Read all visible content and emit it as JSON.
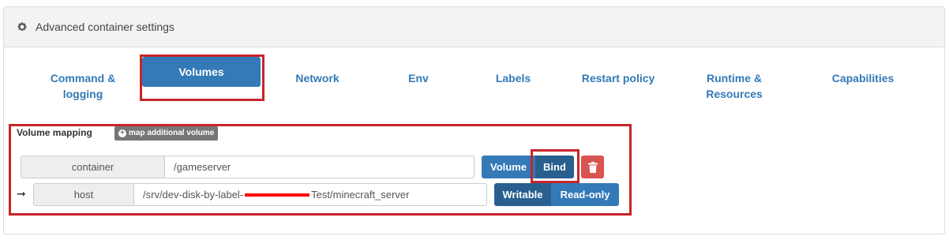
{
  "panel": {
    "title": "Advanced container settings",
    "header_icon": "gear-icon"
  },
  "tabs": [
    {
      "label_lines": [
        "Command &",
        "logging"
      ],
      "active": false
    },
    {
      "label_lines": [
        "Volumes"
      ],
      "active": true
    },
    {
      "label_lines": [
        "Network"
      ],
      "active": false
    },
    {
      "label_lines": [
        "Env"
      ],
      "active": false
    },
    {
      "label_lines": [
        "Labels"
      ],
      "active": false
    },
    {
      "label_lines": [
        "Restart policy"
      ],
      "active": false
    },
    {
      "label_lines": [
        "Runtime &",
        "Resources"
      ],
      "active": false
    },
    {
      "label_lines": [
        "Capabilities"
      ],
      "active": false
    }
  ],
  "volume_mapping": {
    "label": "Volume mapping",
    "add_button": "map additional volume",
    "container_label": "container",
    "container_value": "/gameserver",
    "type_buttons": {
      "volume": "Volume",
      "bind": "Bind",
      "selected": "Bind"
    },
    "host_label": "host",
    "host_value_prefix": "/srv/dev-disk-by-label-",
    "host_value_suffix": "Test/minecraft_server",
    "mode_buttons": {
      "writable": "Writable",
      "readonly": "Read-only",
      "selected": "Writable"
    },
    "arrow": "➞"
  },
  "colors": {
    "primary": "#337ab7",
    "active_dark": "#285f8f",
    "danger": "#d9534f",
    "highlight": "#c8242b",
    "redaction": "#ff0000"
  }
}
